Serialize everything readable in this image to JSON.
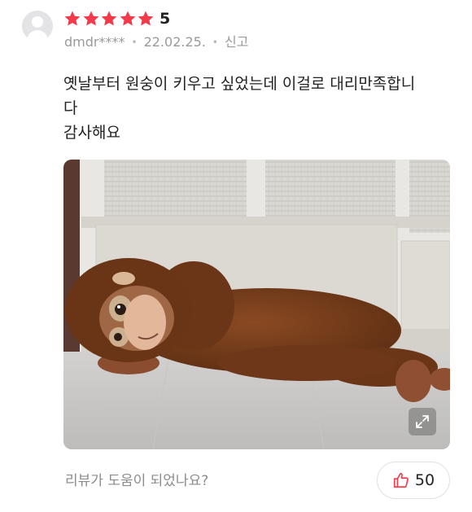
{
  "review": {
    "rating": 5,
    "rating_label": "5",
    "username": "dmdr****",
    "date": "22.02.25.",
    "report_label": "신고",
    "separator": "•",
    "text_lines": [
      "옛날부터 원숭이 키우고 싶었는데 이걸로 대리만족합니",
      "다",
      "감사해요"
    ],
    "photo_icon": "orangutan-plush-photo",
    "expand_icon": "expand-icon"
  },
  "footer": {
    "helpful_prompt": "리뷰가 도움이 되었나요?",
    "like_count": "50",
    "like_icon": "thumbs-up-icon"
  },
  "colors": {
    "star": "#f23a4b",
    "like_icon": "#f23a4b",
    "meta_text": "#9a9a9a"
  }
}
